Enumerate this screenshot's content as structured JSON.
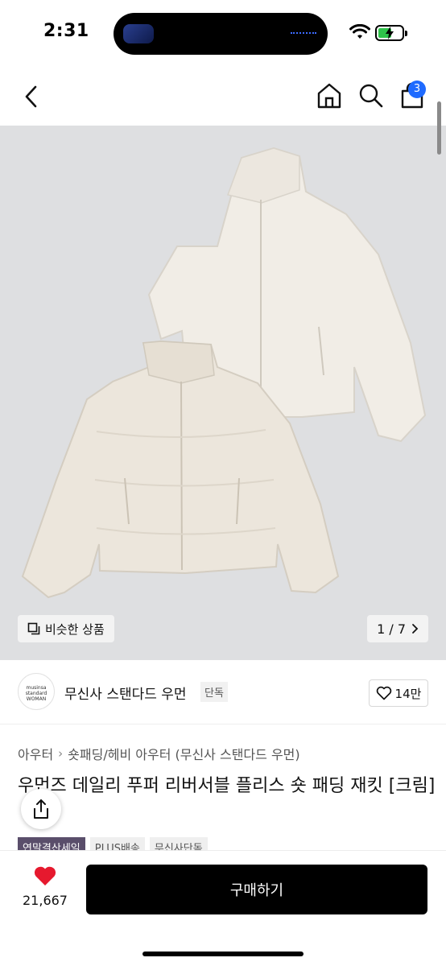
{
  "status_bar": {
    "time": "2:31"
  },
  "nav": {
    "cart_count": "3",
    "icons": [
      "back-chevron-icon",
      "home-icon",
      "search-icon",
      "cart-icon"
    ]
  },
  "hero": {
    "similar_label": "비슷한 상품",
    "pager_text": "1 / 7",
    "background_color": "#dedfe1"
  },
  "brand": {
    "logo_text": "musinsa standard WOMAN",
    "name": "무신사 스탠다드 우먼",
    "tag": "단독",
    "likes": "14만"
  },
  "product": {
    "breadcrumb": [
      "아우터",
      "숏패딩/헤비 아우터 (무신사 스탠다드 우먼)"
    ],
    "title": "우먼즈 데일리 푸퍼 리버서블 플리스 숏 패딩 재킷 [크림]",
    "chips": [
      "연말결산세일",
      "PLUS배송",
      "무신사단독"
    ]
  },
  "bottom": {
    "heart_count": "21,667",
    "buy_label": "구매하기",
    "heart_color": "#e6192e",
    "button_color": "#000000"
  }
}
